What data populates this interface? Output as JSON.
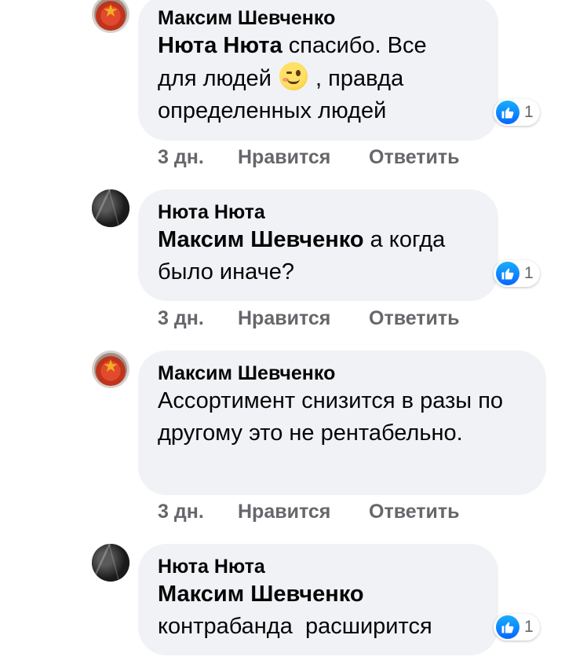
{
  "comments": [
    {
      "author": "Максим Шевченко",
      "avatar": "red-star-badge-avatar",
      "mention": "Нюта Нюта",
      "text_before_emoji": " спасибо. Все для людей ",
      "emoji": "winking-face-emoji",
      "text_after_emoji": " , правда определенных людей",
      "reaction_count": "1",
      "time": "3 дн.",
      "like_label": "Нравится",
      "reply_label": "Ответить"
    },
    {
      "author": "Нюта Нюта",
      "avatar": "dark-photo-avatar",
      "mention": "Максим Шевченко",
      "text": " а когда было иначе?",
      "reaction_count": "1",
      "time": "3 дн.",
      "like_label": "Нравится",
      "reply_label": "Ответить"
    },
    {
      "author": "Максим Шевченко",
      "avatar": "red-star-badge-avatar",
      "text": "Ассортимент снизится в разы по другому это не рентабельно.",
      "time": "3 дн.",
      "like_label": "Нравится",
      "reply_label": "Ответить"
    },
    {
      "author": "Нюта Нюта",
      "avatar": "dark-photo-avatar",
      "mention": "Максим Шевченко",
      "text": "контрабанда  расширится",
      "reaction_count": "1"
    }
  ],
  "colors": {
    "bubble_background": "#f0f2f5",
    "meta_text": "#65676b",
    "like_blue": "#0866ff",
    "text": "#050505"
  }
}
